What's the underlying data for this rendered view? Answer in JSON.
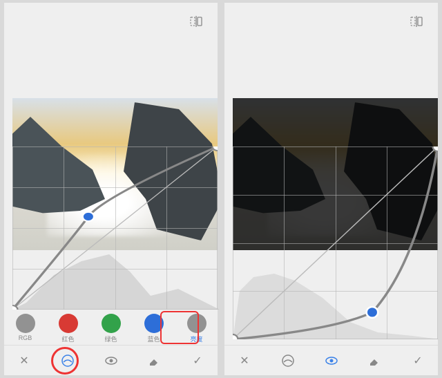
{
  "left": {
    "channels": [
      {
        "key": "rgb",
        "label": "RGB",
        "color": "#929292"
      },
      {
        "key": "red",
        "label": "红色",
        "color": "#d83a34"
      },
      {
        "key": "green",
        "label": "绿色",
        "color": "#32a24a"
      },
      {
        "key": "blue",
        "label": "蓝色",
        "color": "#2d6ed8"
      },
      {
        "key": "lum",
        "label": "亮度",
        "color": "#929292"
      }
    ],
    "active_channel": "lum",
    "highlight_swatch_index": 4,
    "highlight_bottom_index": 1,
    "curve_points": [
      {
        "x": 0.0,
        "y": 0.0
      },
      {
        "x": 0.37,
        "y": 0.57
      },
      {
        "x": 1.0,
        "y": 1.0
      }
    ]
  },
  "right": {
    "active_bottom_index": 2,
    "curve_points": [
      {
        "x": 0.0,
        "y": 0.0
      },
      {
        "x": 0.68,
        "y": 0.14
      },
      {
        "x": 1.0,
        "y": 1.0
      }
    ]
  },
  "icons": {
    "close": "✕",
    "check": "✓"
  }
}
